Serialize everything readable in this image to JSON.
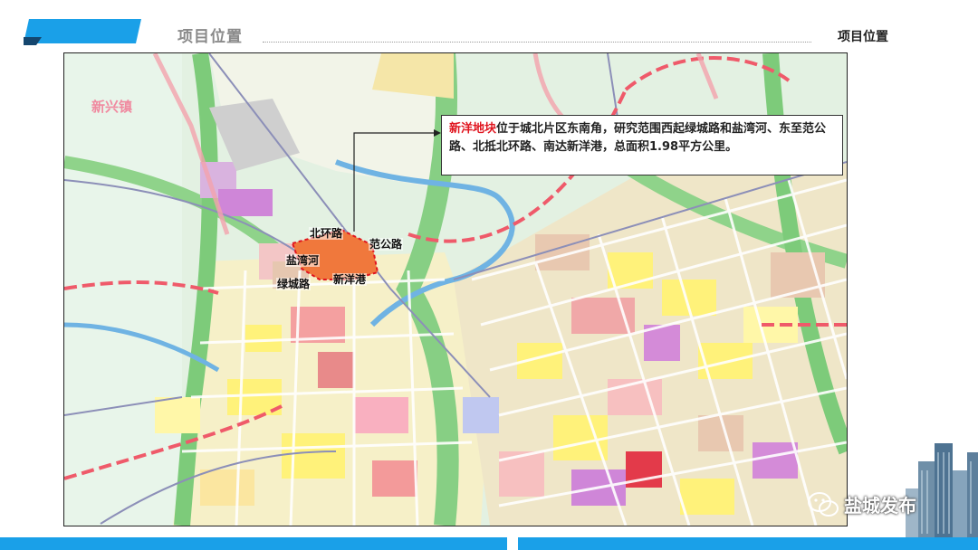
{
  "header": {
    "title": "项目位置",
    "right_label": "项目位置"
  },
  "callout": {
    "highlight": "新洋地块",
    "text": "位于城北片区东南角，研究范围西起绿城路和盐湾河、东至范公路、北抵北环路、南达新洋港，总面积1.98平方公里。"
  },
  "map": {
    "town_label": "新兴镇",
    "road_labels": {
      "north": "北环路",
      "east": "范公路",
      "west_river": "盐湾河",
      "west_road": "绿城路",
      "south": "新洋港"
    }
  },
  "watermark": {
    "text": "盐城发布",
    "icon": "wechat-icon"
  },
  "colors": {
    "accent_blue": "#1aa0e8",
    "highlight_red": "#e0141e",
    "plot_orange": "#f0783c"
  }
}
